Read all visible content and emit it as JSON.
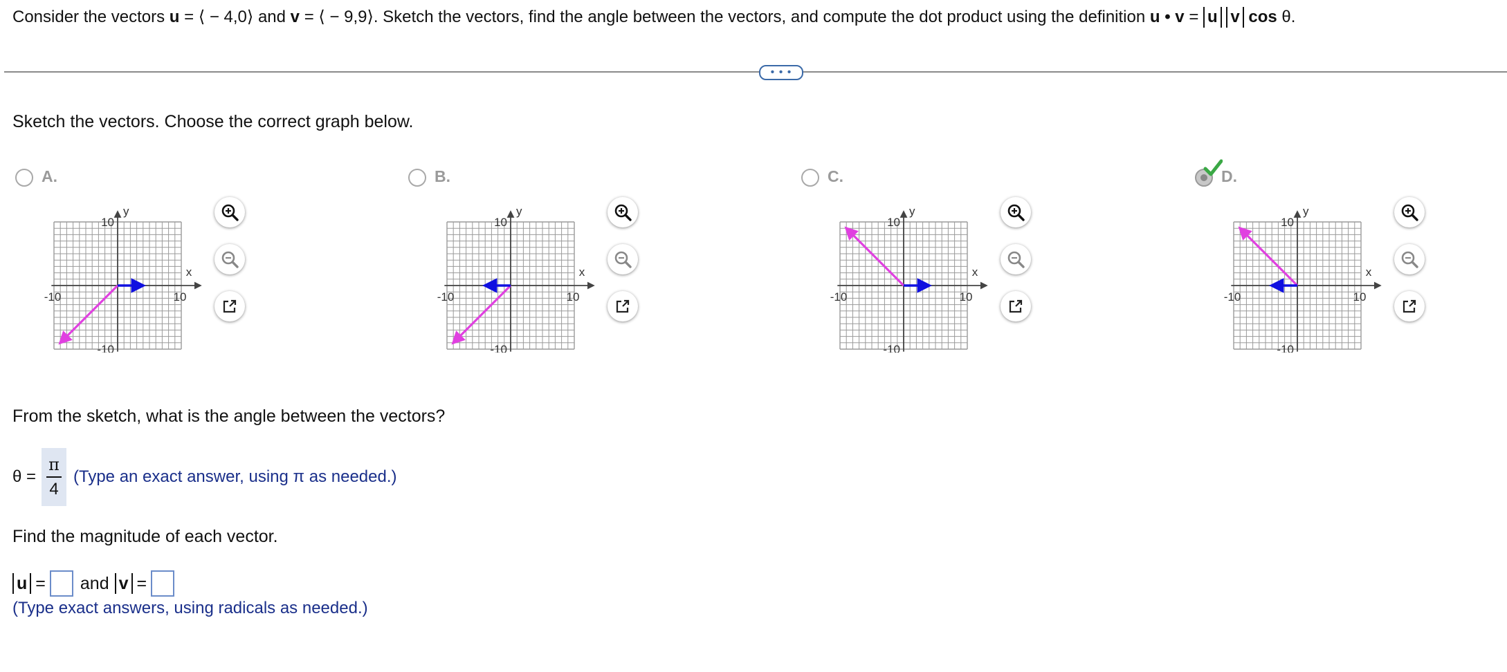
{
  "question": {
    "intro": "Consider the vectors",
    "u_symbol": "u",
    "u_equals": "=",
    "u_value": "⟨ − 4,0⟩",
    "and": "and",
    "v_symbol": "v",
    "v_equals": "=",
    "v_value": "⟨ − 9,9⟩",
    "rest": ". Sketch the vectors, find the angle between the vectors, and compute the dot product using the definition",
    "formula_u": "u",
    "formula_dot": "•",
    "formula_v": "v",
    "formula_eq": "=",
    "formula_abs_u": "u",
    "formula_abs_v": "v",
    "formula_cos": "cos",
    "formula_theta": "θ."
  },
  "more_button": "• • •",
  "sketch_prompt": "Sketch the vectors. Choose the correct graph below.",
  "choices": [
    {
      "letter": "A.",
      "selected": false,
      "u_arrow": [
        0,
        0,
        4,
        0
      ],
      "v_arrow": [
        0,
        0,
        -9,
        -9
      ]
    },
    {
      "letter": "B.",
      "selected": false,
      "u_arrow": [
        0,
        0,
        -4,
        0
      ],
      "v_arrow": [
        0,
        0,
        -9,
        -9
      ]
    },
    {
      "letter": "C.",
      "selected": false,
      "u_arrow": [
        0,
        0,
        4,
        0
      ],
      "v_arrow": [
        0,
        0,
        -9,
        9
      ]
    },
    {
      "letter": "D.",
      "selected": true,
      "u_arrow": [
        0,
        0,
        -4,
        0
      ],
      "v_arrow": [
        0,
        0,
        -9,
        9
      ]
    }
  ],
  "graph": {
    "x_label": "x",
    "y_label": "y",
    "tick_pos": "10",
    "tick_neg": "-10",
    "u_color": "#1010e0",
    "v_color": "#e040e0",
    "grid_color": "#9a9a9a",
    "check_color": "#3aa845"
  },
  "tools": {
    "zoom_in": "zoom-in-icon",
    "zoom_out": "zoom-out-icon",
    "popout": "popout-icon"
  },
  "angle_prompt": "From the sketch, what is the angle between the vectors?",
  "angle": {
    "label": "θ =",
    "numerator": "π",
    "denominator": "4",
    "hint": "(Type an exact answer, using π as needed.)"
  },
  "magnitude_prompt": "Find the magnitude of each vector.",
  "magnitude": {
    "u_label": "u",
    "eq": "=",
    "and": "and",
    "v_label": "v",
    "u_value": "",
    "v_value": "",
    "hint": "(Type exact answers, using radicals as needed.)"
  }
}
